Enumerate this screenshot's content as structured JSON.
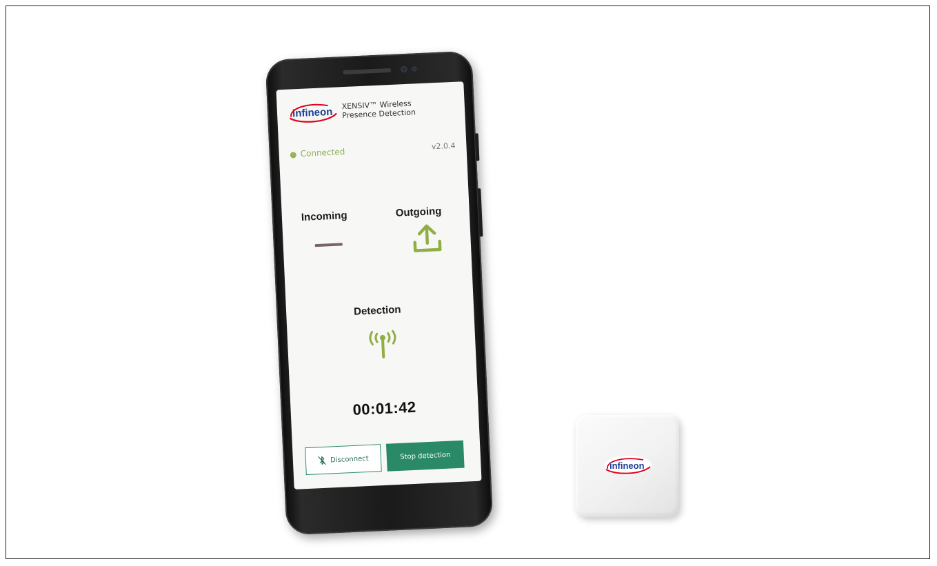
{
  "app": {
    "brand_logo_text": "infineon",
    "brand_line1": "XENSIV™ Wireless",
    "brand_line2": "Presence Detection",
    "version": "v2.0.4"
  },
  "status": {
    "text": "Connected",
    "color": "#95b55a"
  },
  "indicators": {
    "incoming_label": "Incoming",
    "outgoing_label": "Outgoing",
    "detection_label": "Detection",
    "incoming_icon": "dash-icon",
    "outgoing_icon": "upload-icon",
    "detection_icon": "antenna-icon",
    "active_color": "#8fae45",
    "inactive_color": "#7a6266"
  },
  "timer": {
    "value": "00:01:42"
  },
  "actions": {
    "disconnect_label": "Disconnect",
    "disconnect_icon": "bluetooth-off-icon",
    "stop_label": "Stop detection",
    "primary_color": "#2a8a67"
  },
  "device": {
    "logo_text": "infineon"
  },
  "colors": {
    "brand_blue": "#1b3f93",
    "brand_red": "#e2001a"
  }
}
